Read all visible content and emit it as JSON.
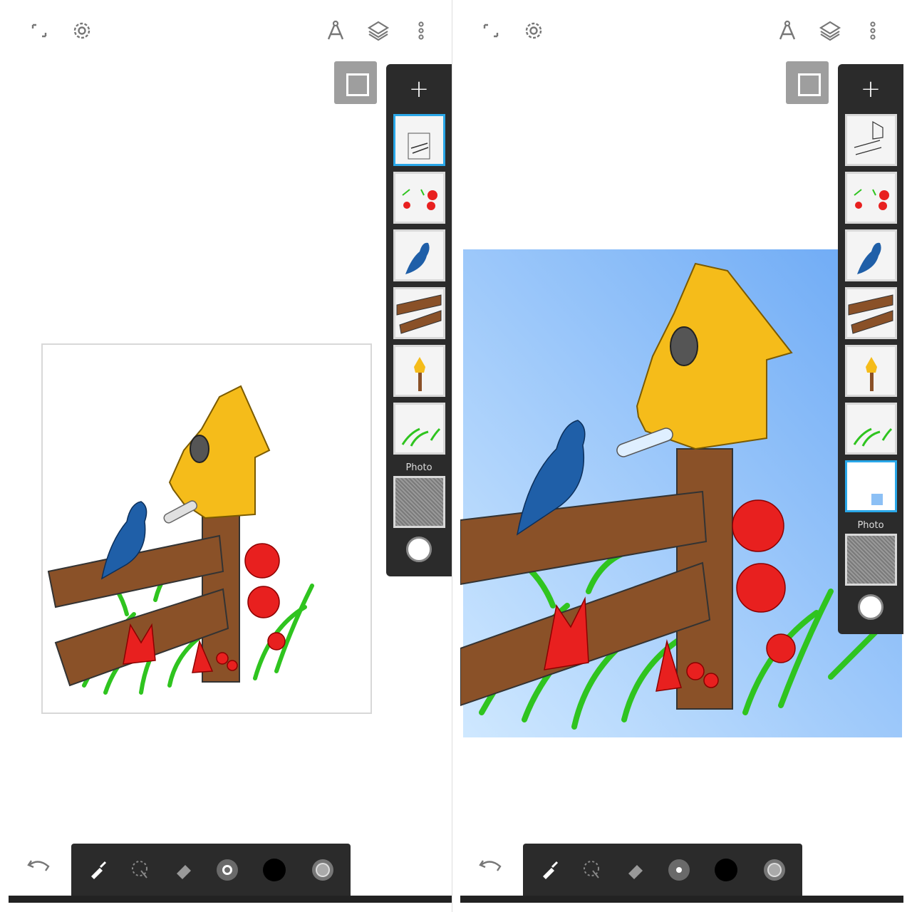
{
  "icons": {
    "fullscreen": "fullscreen-icon",
    "settings": "gear-icon",
    "ruler": "compass-icon",
    "layers": "layers-icon",
    "more": "more-vertical-icon",
    "undo": "undo-icon",
    "brush": "brush-icon",
    "lasso": "lasso-select-icon",
    "eraser": "eraser-icon",
    "brush_size": "brush-size-icon",
    "color": "color-swatch-icon",
    "opacity": "opacity-icon"
  },
  "left": {
    "layer_panel": {
      "add_label": "+",
      "photo_label": "Photo",
      "layers": [
        "sketch",
        "flowers",
        "bird",
        "fence",
        "birdhouse",
        "grass"
      ]
    }
  },
  "right": {
    "layer_panel": {
      "add_label": "+",
      "photo_label": "Photo",
      "layers": [
        "sketch",
        "flowers",
        "bird",
        "fence",
        "birdhouse",
        "grass",
        "sky"
      ]
    }
  },
  "colors": {
    "panel_bg": "#2b2b2b",
    "active_border": "#2aa7e8",
    "sky_top": "#6aa8f5",
    "sky_bottom": "#cfe8ff",
    "birdhouse": "#f5bc1a",
    "fence": "#8a5128",
    "flower": "#e8201f",
    "grass": "#2fc41f",
    "bird": "#1f5fa8"
  }
}
